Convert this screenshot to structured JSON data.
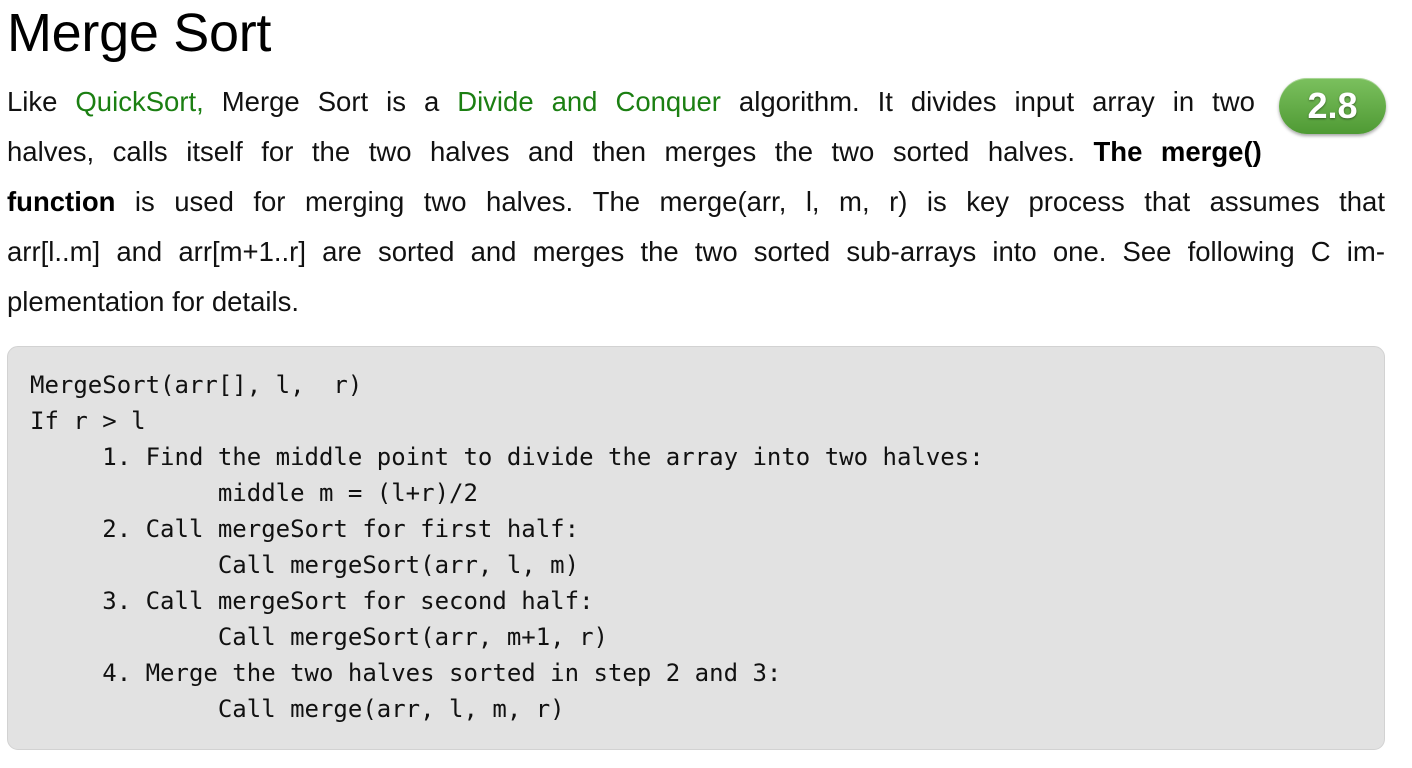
{
  "page": {
    "title": "Merge Sort"
  },
  "rating": {
    "value": "2.8",
    "color": "#5fa844"
  },
  "intro": {
    "line1": {
      "t1": "Like",
      "link1": "QuickSort,",
      "t2": "Merge",
      "t3": "Sort",
      "t4": "is",
      "t5": "a",
      "link2a": "Divide",
      "link2b": "and",
      "link2c": "Conquer",
      "t6": "algorithm.",
      "t7": "It",
      "t8": "divides",
      "t9": "input",
      "t10": "array",
      "t11": "in",
      "t12": "two"
    },
    "line2": {
      "t1": "halves,",
      "t2": "calls",
      "t3": "itself",
      "t4": "for",
      "t5": "the",
      "t6": "two",
      "t7": "halves",
      "t8": "and",
      "t9": "then",
      "t10": "merges",
      "t11": "the",
      "t12": "two",
      "t13": "sorted",
      "t14": "halves.",
      "b1": "The",
      "b2": "merge()"
    },
    "line3": {
      "b1": "function",
      "t1": "is",
      "t2": "used",
      "t3": "for",
      "t4": "merging",
      "t5": "two",
      "t6": "halves.",
      "t7": "The",
      "t8": "merge(arr,",
      "t9": "l,",
      "t10": "m,",
      "t11": "r)",
      "t12": "is",
      "t13": "key",
      "t14": "process",
      "t15": "that",
      "t16": "assumes",
      "t17": "that"
    },
    "line4": {
      "t1": "arr[l..m]",
      "t2": "and",
      "t3": "arr[m+1..r]",
      "t4": "are",
      "t5": "sorted",
      "t6": "and",
      "t7": "merges",
      "t8": "the",
      "t9": "two",
      "t10": "sorted",
      "t11": "sub-arrays",
      "t12": "into",
      "t13": "one.",
      "t14": "See",
      "t15": "following",
      "t16": "C",
      "t17": "im-"
    },
    "line5": "plementation for details."
  },
  "code": {
    "lines": [
      "MergeSort(arr[], l,  r)",
      "If r > l",
      "     1. Find the middle point to divide the array into two halves:",
      "             middle m = (l+r)/2",
      "     2. Call mergeSort for first half:",
      "             Call mergeSort(arr, l, m)",
      "     3. Call mergeSort for second half:",
      "             Call mergeSort(arr, m+1, r)",
      "     4. Merge the two halves sorted in step 2 and 3:",
      "             Call merge(arr, l, m, r)"
    ]
  }
}
